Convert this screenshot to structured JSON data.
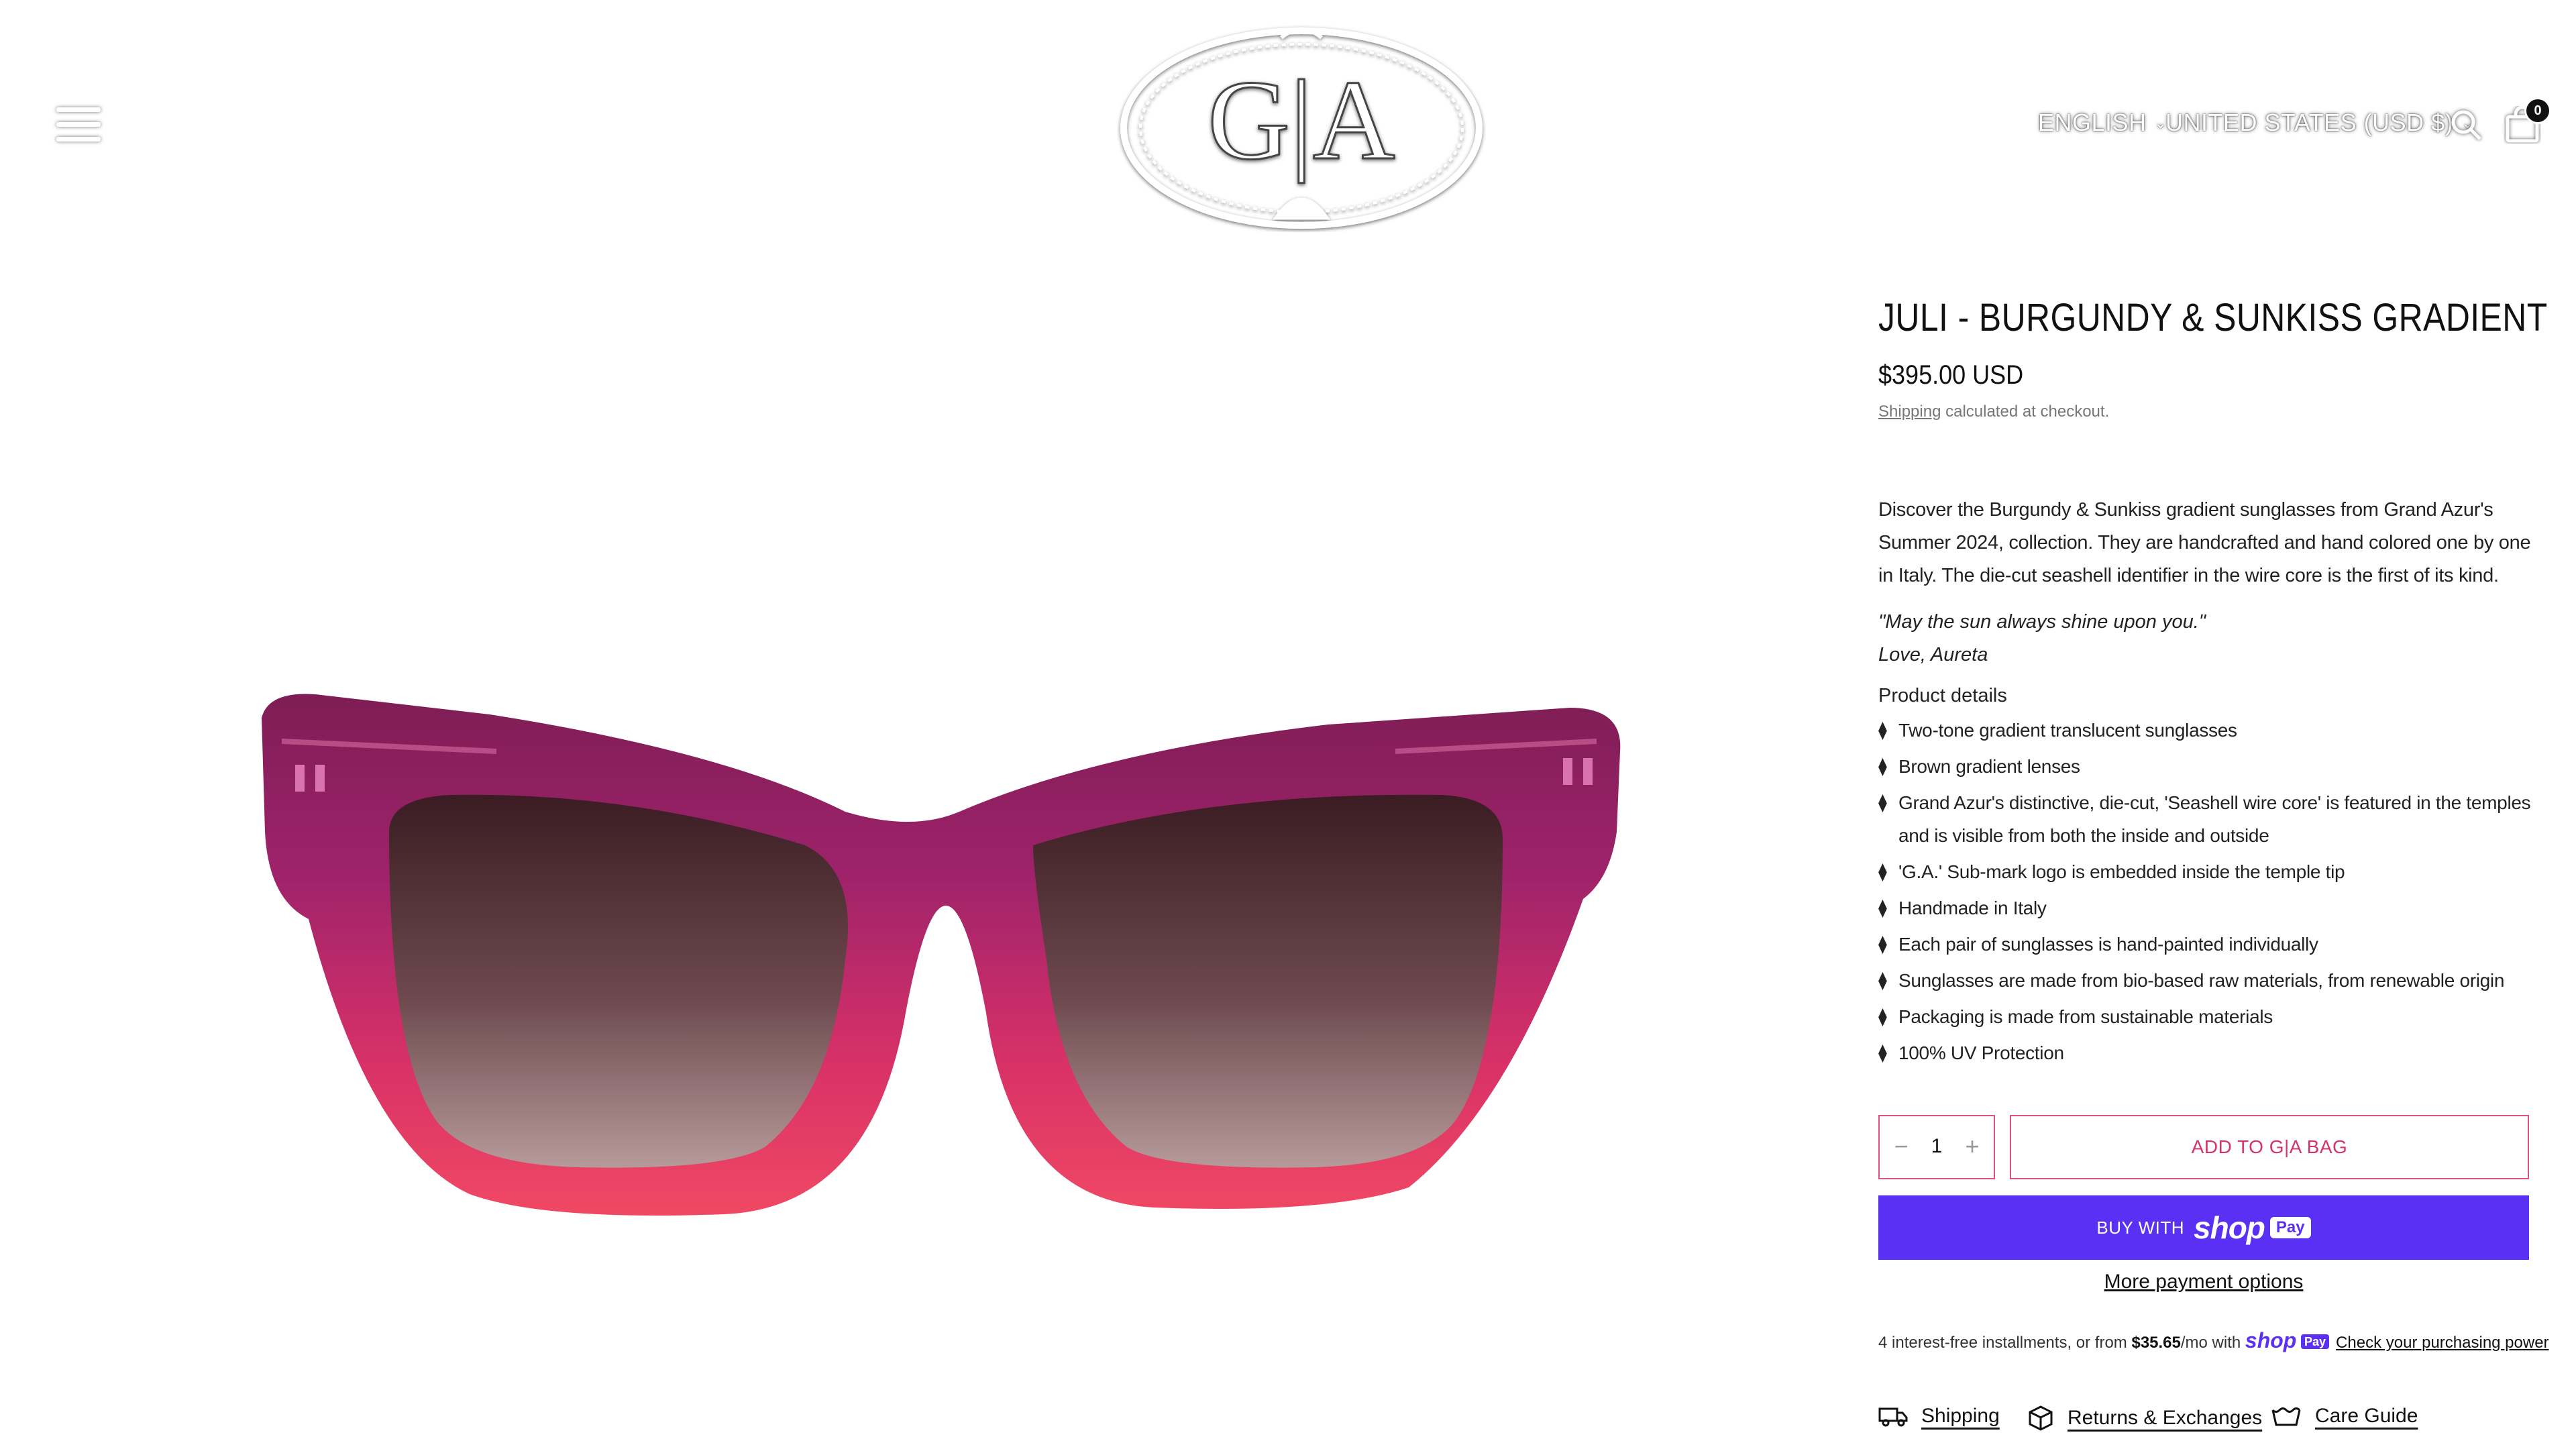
{
  "header": {
    "menu_icon": "hamburger-icon",
    "logo_text": "G|A",
    "language": "ENGLISH",
    "country": "UNITED STATES (USD $)",
    "search_icon": "search-icon",
    "cart_icon": "bag-icon",
    "cart_count": "0"
  },
  "product": {
    "title": "JULI - BURGUNDY & SUNKISS GRADIENT",
    "price": "$395.00 USD",
    "shipping_link": "Shipping",
    "shipping_note": " calculated at checkout.",
    "description": "Discover the Burgundy & Sunkiss gradient sunglasses from Grand Azur's Summer 2024, collection. They are handcrafted and hand colored one by one in Italy. The die-cut seashell identifier in the wire core is the first of its kind.",
    "quote": "\"May the sun always shine upon you.\"",
    "signoff": "Love, Aureta",
    "details_heading": "Product details",
    "details": [
      "Two-tone gradient translucent sunglasses",
      "Brown gradient lenses",
      "Grand Azur's distinctive, die-cut, 'Seashell wire core' is featured in the temples and is visible from both the inside and outside",
      "'G.A.' Sub-mark logo is embedded inside the temple tip",
      "Handmade in Italy",
      "Each pair of sunglasses is hand-painted individually",
      "Sunglasses are made from bio-based raw materials, from renewable origin",
      "Packaging is made from sustainable materials",
      "100% UV Protection"
    ],
    "bullet_glyph": "⧫"
  },
  "purchase": {
    "quantity": "1",
    "minus": "−",
    "plus": "+",
    "add_to_bag": "ADD TO G|A BAG",
    "buy_with": "BUY WITH",
    "shop_logo": "shop",
    "pay_badge": "Pay",
    "more_payment": "More payment options",
    "installments_prefix": "4 interest-free installments, or from ",
    "installments_amount": "$35.65",
    "installments_suffix": "/mo with ",
    "installments_shop": "shop",
    "installments_pay": "Pay",
    "check_power": "Check your purchasing power"
  },
  "links": {
    "shipping": "Shipping",
    "returns": "Returns & Exchanges",
    "care": "Care Guide"
  },
  "colors": {
    "accent_pink": "#e04f86",
    "shop_purple": "#5a31f4",
    "frame_burgundy": "#8e1a5e",
    "frame_red": "#e8285a"
  }
}
